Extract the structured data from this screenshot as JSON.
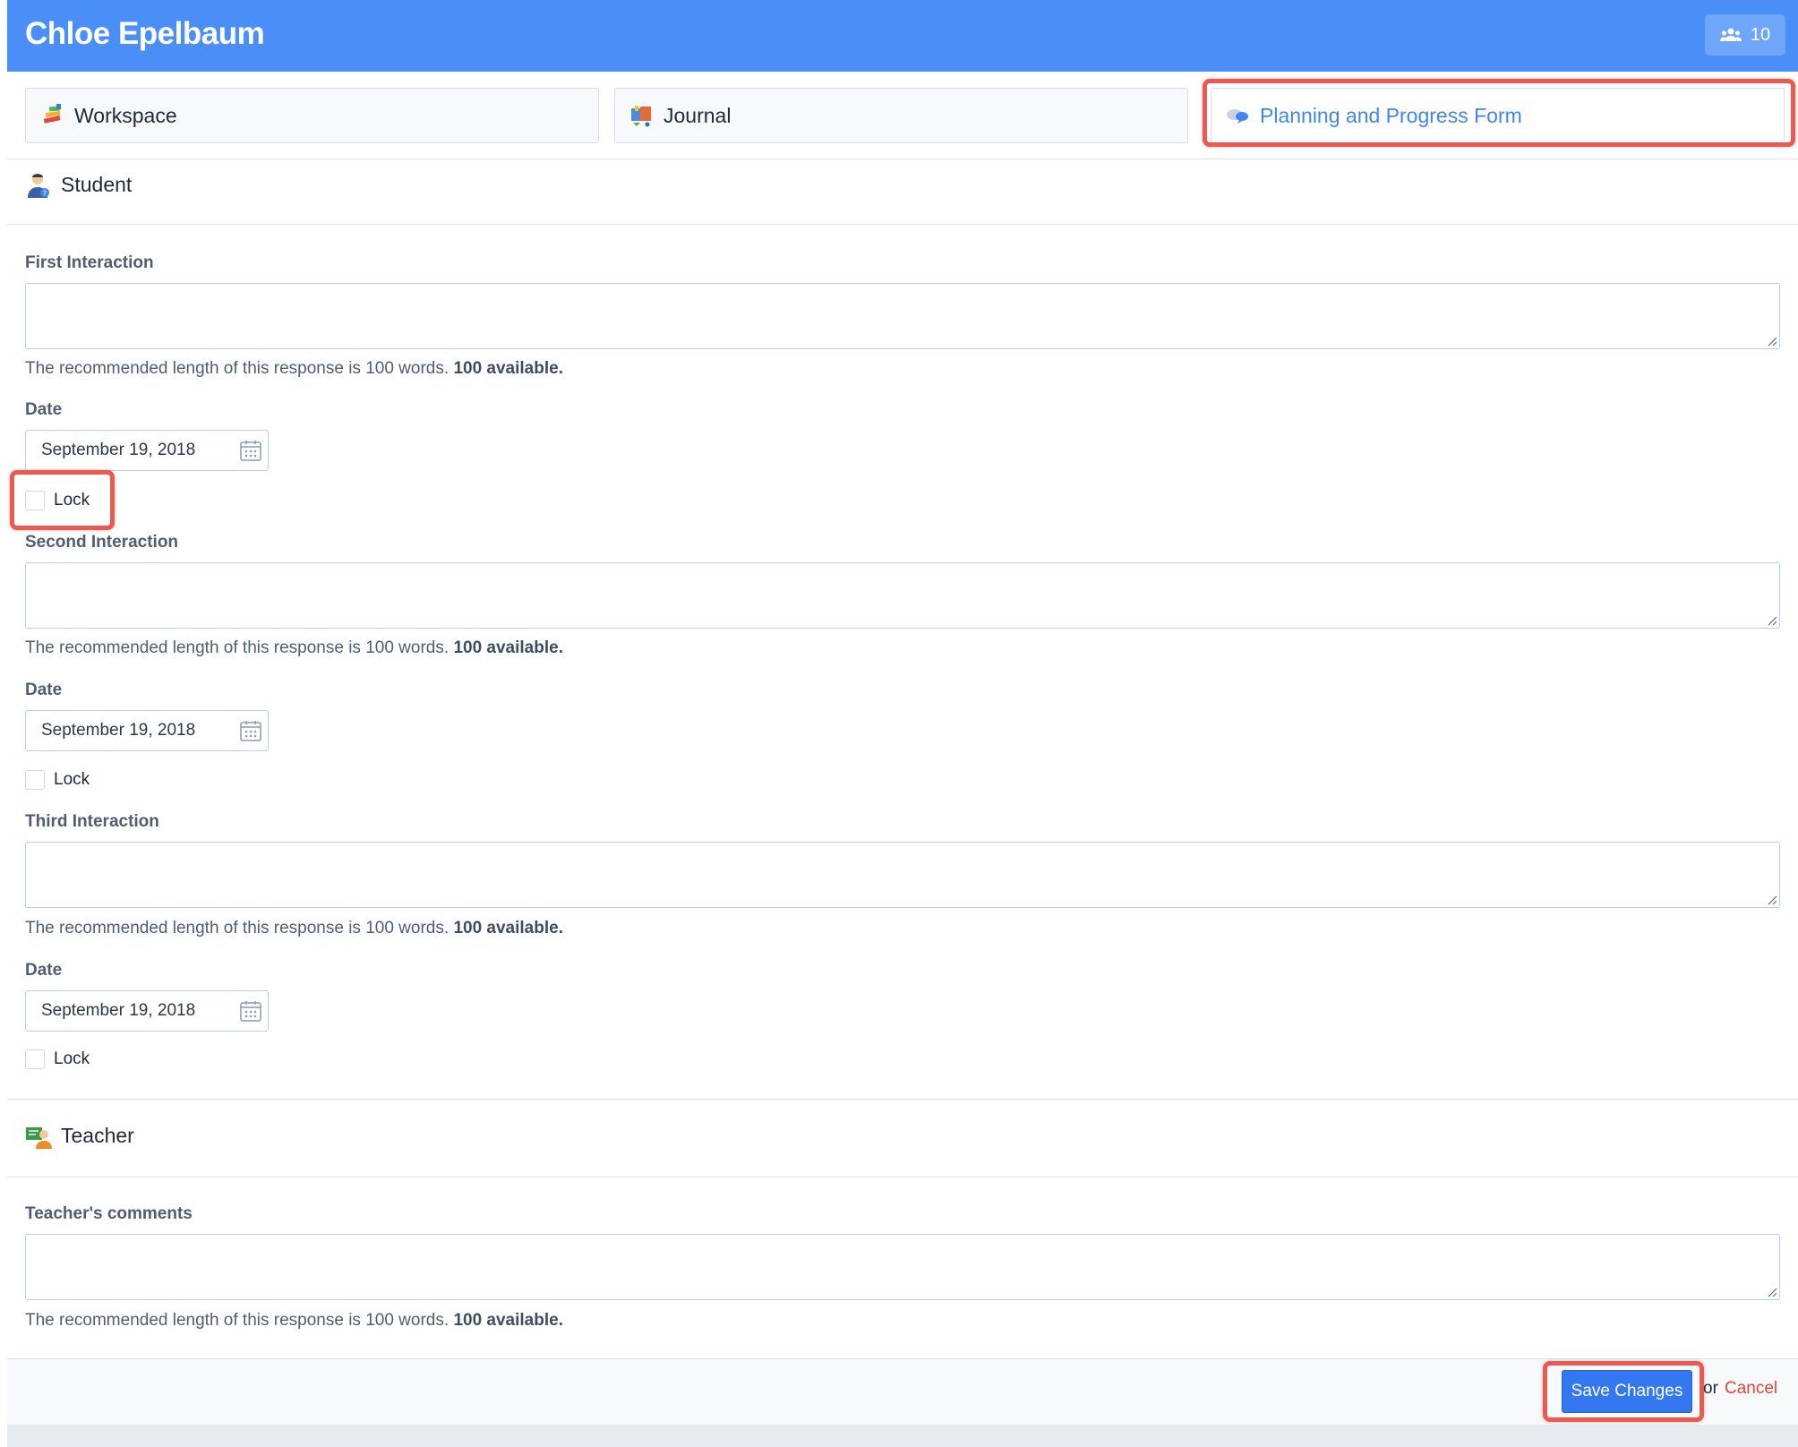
{
  "header": {
    "title": "Chloe Epelbaum",
    "badge_count": "10",
    "badge_icon": "users-icon"
  },
  "tabs": [
    {
      "label": "Workspace",
      "icon": "workspace-icon",
      "active": false
    },
    {
      "label": "Journal",
      "icon": "journal-icon",
      "active": false
    },
    {
      "label": "Planning and Progress Form",
      "icon": "speech-bubble-icon",
      "active": true
    }
  ],
  "student_section": {
    "title": "Student",
    "icon": "student-icon",
    "interactions": [
      {
        "label": "First Interaction",
        "value": "",
        "hint": "The recommended length of this response is 100 words.",
        "available": "100 available.",
        "date_label": "Date",
        "date_value": "September 19, 2018",
        "lock_label": "Lock",
        "locked": false
      },
      {
        "label": "Second Interaction",
        "value": "",
        "hint": "The recommended length of this response is 100 words.",
        "available": "100 available.",
        "date_label": "Date",
        "date_value": "September 19, 2018",
        "lock_label": "Lock",
        "locked": false
      },
      {
        "label": "Third Interaction",
        "value": "",
        "hint": "The recommended length of this response is 100 words.",
        "available": "100 available.",
        "date_label": "Date",
        "date_value": "September 19, 2018",
        "lock_label": "Lock",
        "locked": false
      }
    ]
  },
  "teacher_section": {
    "title": "Teacher",
    "icon": "teacher-icon",
    "comments_label": "Teacher's comments",
    "comments_value": "",
    "hint": "The recommended length of this response is 100 words.",
    "available": "100 available."
  },
  "footer": {
    "save_label": "Save Changes",
    "or_text": "or",
    "cancel_label": "Cancel"
  },
  "colors": {
    "header_bg": "#4a8ff7",
    "accent": "#3e86f0",
    "highlight": "#ec5a4f",
    "cancel": "#e0453a"
  }
}
